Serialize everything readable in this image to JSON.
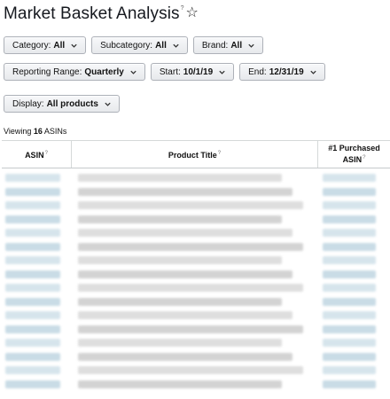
{
  "page": {
    "title": "Market Basket Analysis",
    "title_info_glyph": "?",
    "star_glyph": "☆"
  },
  "filters": {
    "category": {
      "label": "Category:",
      "value": "All"
    },
    "subcategory": {
      "label": "Subcategory:",
      "value": "All"
    },
    "brand": {
      "label": "Brand:",
      "value": "All"
    },
    "reporting_range": {
      "label": "Reporting Range:",
      "value": "Quarterly"
    },
    "start": {
      "label": "Start:",
      "value": "10/1/19"
    },
    "end": {
      "label": "End:",
      "value": "12/31/19"
    },
    "display": {
      "label": "Display:",
      "value": "All products"
    }
  },
  "summary": {
    "prefix": "Viewing",
    "count": "16",
    "suffix": "ASINs"
  },
  "table": {
    "columns": [
      {
        "key": "asin",
        "label": "ASIN",
        "info": "?"
      },
      {
        "key": "product_title",
        "label": "Product Title",
        "info": "?"
      },
      {
        "key": "purchased_1",
        "label_line1": "#1 Purchased",
        "label_line2": "ASIN",
        "info": "?"
      }
    ],
    "row_count": 16,
    "cells_obscured": true
  },
  "colors": {
    "asin_blur": "#c9dce6",
    "title_blur": "#cfcfcf",
    "button_border": "#adb1b8"
  },
  "icons": {
    "dropdown": "chevron-down-icon",
    "favorite": "star-outline-icon"
  }
}
